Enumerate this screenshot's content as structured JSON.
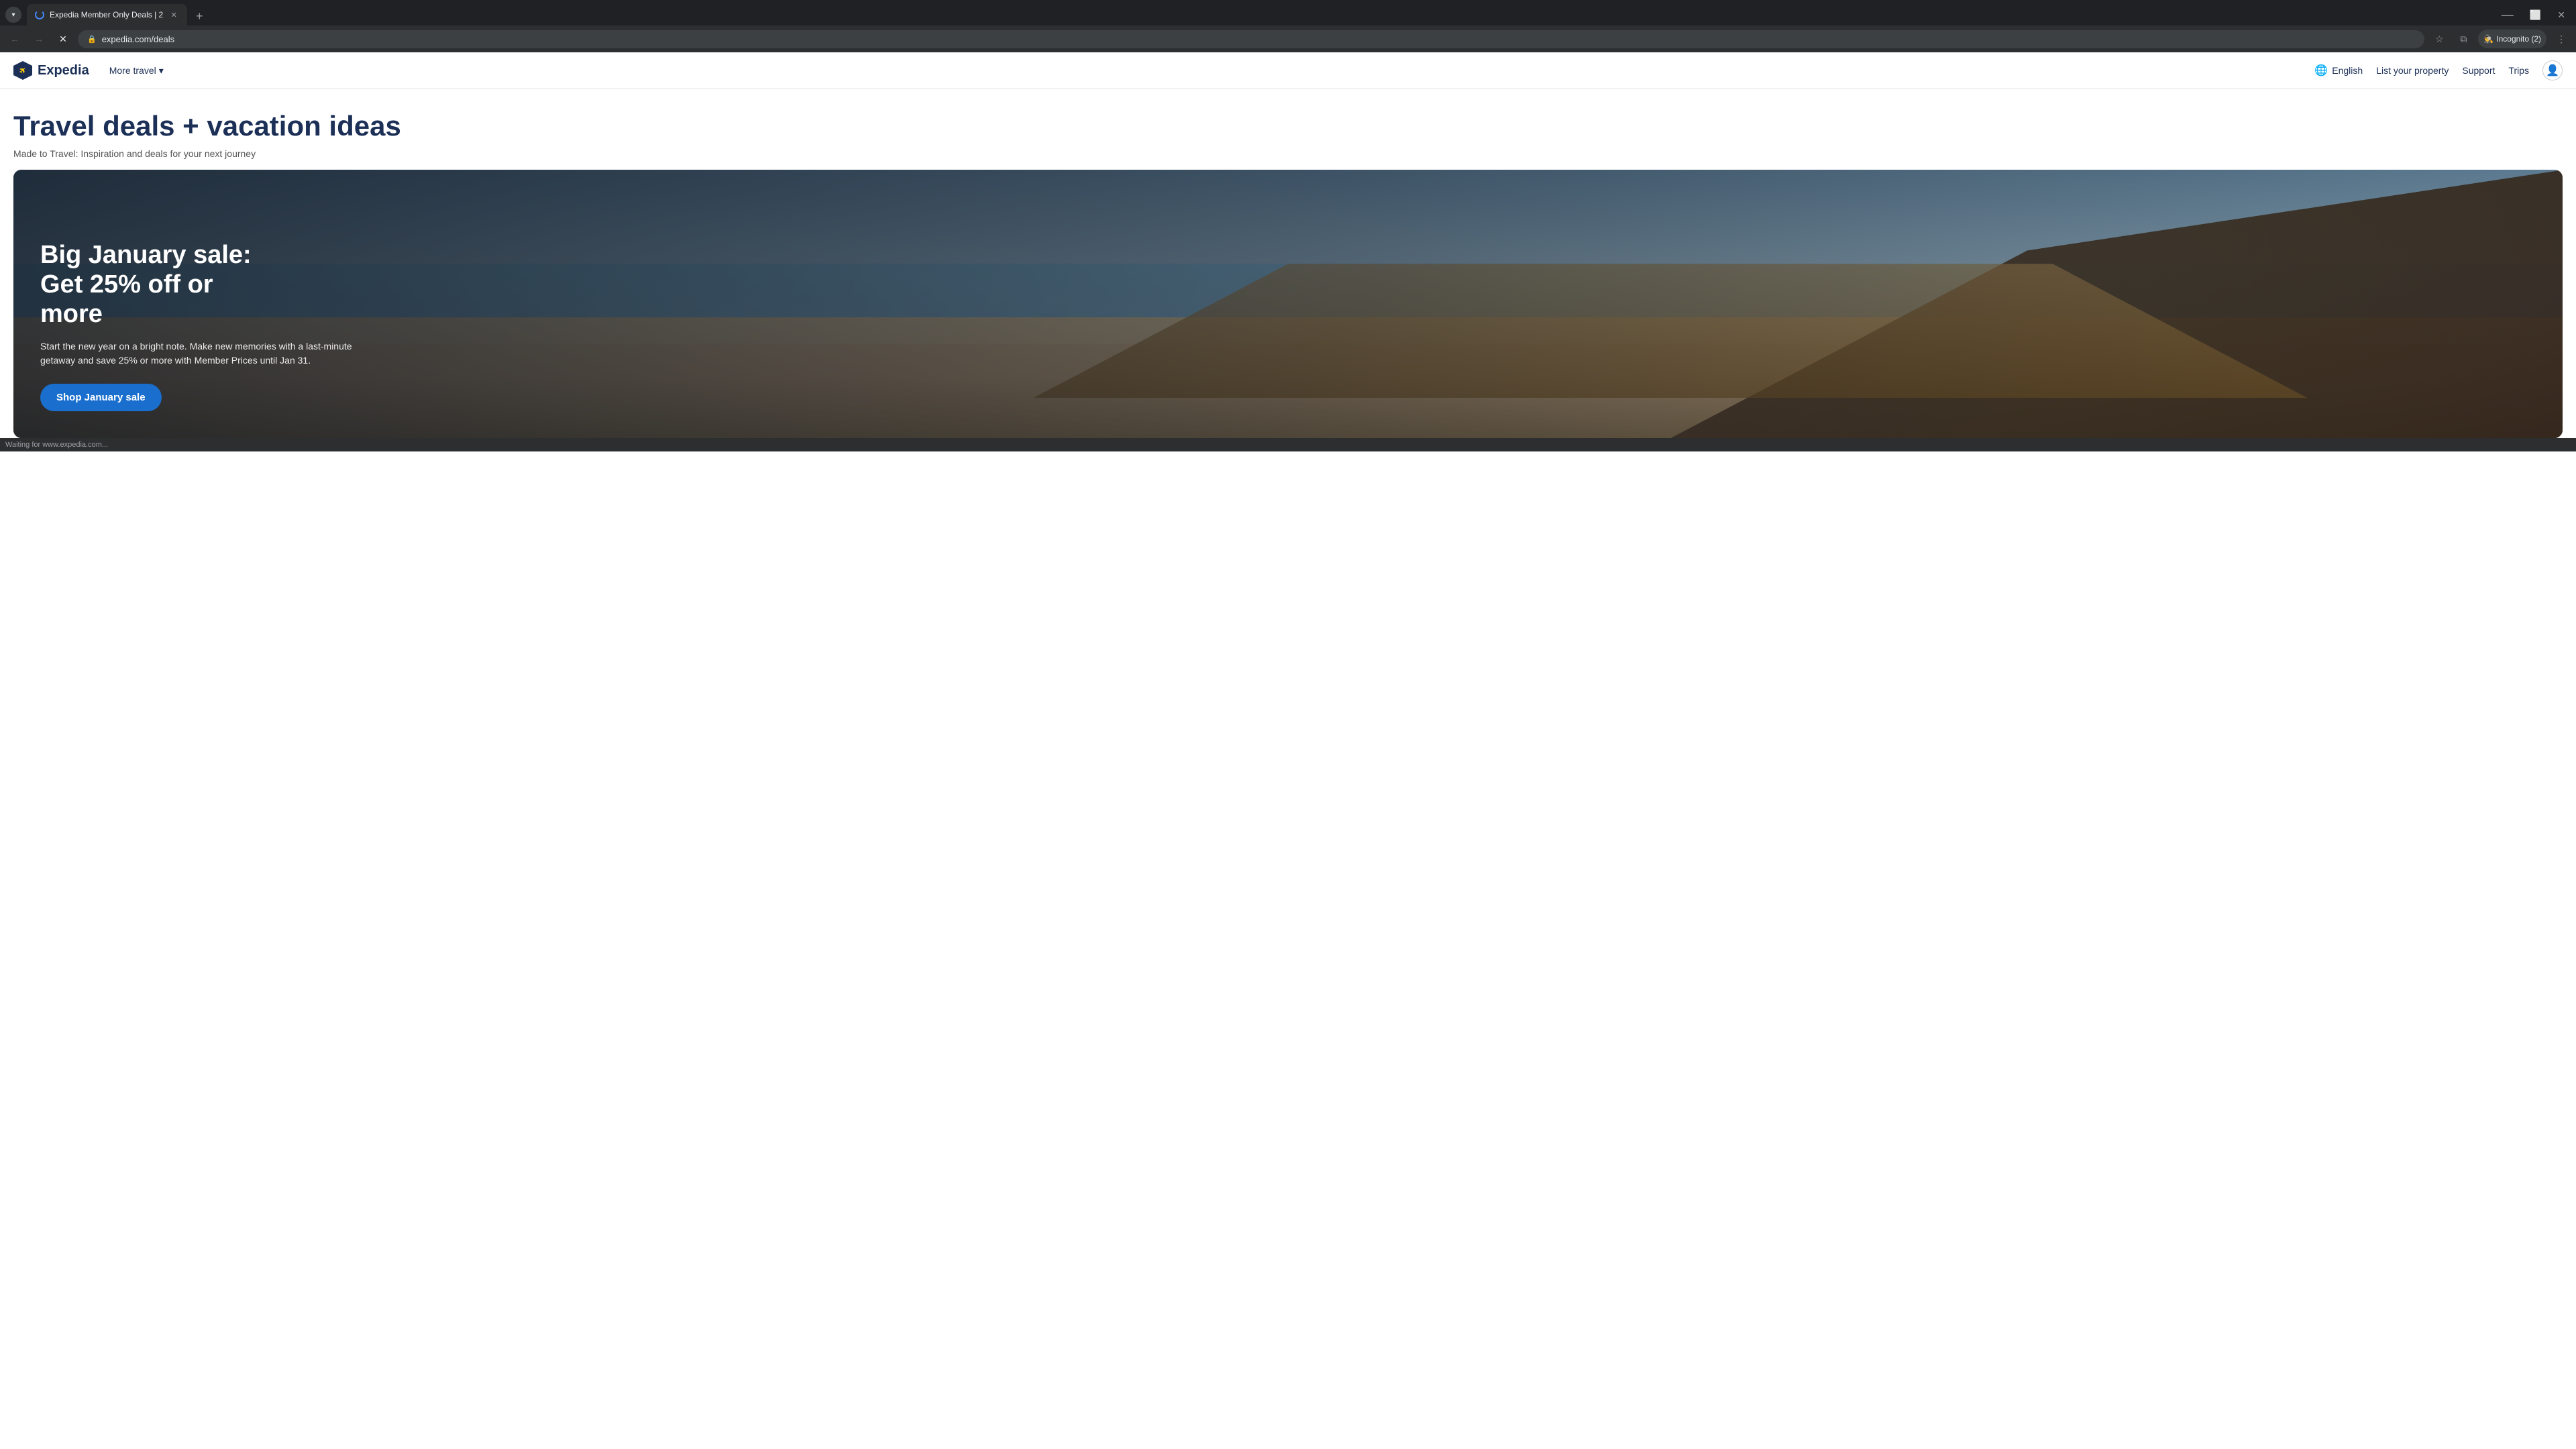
{
  "browser": {
    "tab_menu_label": "▾",
    "tab": {
      "title": "Expedia Member Only Deals | 2",
      "favicon_alt": "loading"
    },
    "new_tab_label": "+",
    "nav": {
      "back_icon": "←",
      "forward_icon": "→",
      "reload_icon": "✕",
      "url": "expedia.com/deals",
      "lock_icon": "🔒",
      "bookmark_icon": "☆",
      "split_icon": "⧉"
    },
    "incognito_label": "Incognito (2)",
    "more_icon": "⋮"
  },
  "site": {
    "logo_text": "Expedia",
    "logo_icon": "✈",
    "nav": {
      "more_travel_label": "More travel",
      "dropdown_icon": "▾",
      "english_label": "English",
      "list_property_label": "List your property",
      "support_label": "Support",
      "trips_label": "Trips",
      "user_icon": "👤"
    },
    "page": {
      "title": "Travel deals + vacation ideas",
      "subtitle": "Made to Travel: Inspiration and deals for your next journey"
    },
    "banner": {
      "heading": "Big January sale:\nGet 25% off or\nmore",
      "body": "Start the new year on a bright note. Make new memories with a last-minute getaway and save 25% or more with Member Prices until Jan 31.",
      "cta_label": "Shop January sale"
    }
  },
  "status_bar": {
    "text": "Waiting for www.expedia.com..."
  }
}
